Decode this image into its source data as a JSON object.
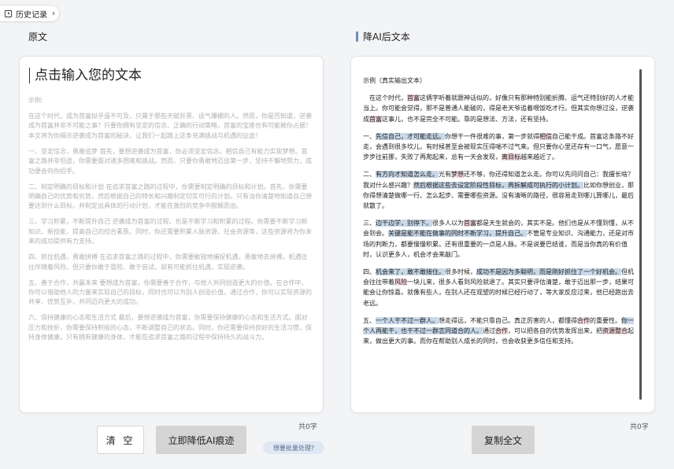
{
  "history": {
    "label": "历史记录"
  },
  "left": {
    "label": "原文",
    "placeholder": "点击输入您的文本",
    "sample": [
      "示例:",
      "在这个时代，成为首富似乎遥不可及，只属于那些天赋异禀、运气爆棚的人。然而，你是否知道，逆袭成为首富并非不可能之事？只要你拥有坚定的信念、正确的行动策略，首富的宝座也有可能被你占据！本文将为你揭示逆袭成为首富的秘诀，让我们一起踏上这条充满挑战与机遇的征途！",
      "一、坚定信念，勇敢追梦 首先，要想逆袭成为首富，你必须坚定信念。相信自己有能力实现梦想。首富之路并非坦途，你需要面对诸多困难和挑战。然而，只要你勇敢地迈出第一步，坚持不懈地努力，成功便会向你招手。",
      "二、制定明确的目标和计划 在追求首富之路的过程中，你需要制定明确的目标和计划。首先，你需要明确自己的优势和劣势，然后根据自己的特长和兴趣制定切实可行的计划。只有当你清楚地知道自己想要达到什么目标，并制定出具体的行动计划，才能在激烈的竞争中脱颖而出。",
      "三、学习积累，不断提升自己 逆袭成为首富的过程，也是不断学习和积累的过程。你需要不断学习新知识、新技能，提高自己的综合素质。同时，你还需要积累人脉资源、社会资源等，这些资源将为你未来的成功提供有力支持。",
      "四、抓住机遇，勇敢拼搏 在追求首富之路的过程中，你需要敏锐地捕捉机遇，勇敢地去拼搏。机遇往往伴随着风险，但只要你敢于冒险、敢于尝试，就有可能抓住机遇，实现逆袭。",
      "五、善于合作，共赢未来 要想成为首富，你需要善于合作，与他人共同创造更大的价值。在合作中，你可以借助他人的力量来实现自己的目标，同时也可以为别人创造价值。通过合作，你可以实现资源的共享、优势互补，共同迈向更大的成功。",
      "六、保持健康的心态和生活方式 最后，要想逆袭成为首富，你需要保持健康的心态和生活方式。面对压力和挫折，你需要保持积极的心态，不断调整自己的状态。同时，你还需要保持良好的生活习惯，保持身体健康。只有拥有健康的身体，才能在追求首富之路的过程中保持持久的战斗力。"
    ],
    "count": "共0字",
    "clear_label": "清 空",
    "reduce_label": "立即降低AI痕迹",
    "batch_label": "想要批量处理?"
  },
  "right": {
    "label": "降AI后文本",
    "count": "共0字",
    "copy_label": "复制全文",
    "output": [
      {
        "segs": [
          {
            "t": "示例（真实输出文本）"
          }
        ]
      },
      {
        "segs": [
          {
            "t": "　在这个时代，"
          },
          {
            "t": "首富",
            "c": "p"
          },
          {
            "t": "这俩字听着就跟神话似的，好像只有那种特别能折腾、运气还特别好的人才能当上。你可能会觉得，那不是普通人能碰的，得是老天爷追着喂饭吃才行。但其实你想过没，逆袭成"
          },
          {
            "t": "首富",
            "c": "p"
          },
          {
            "t": "这事儿，也不是完全不可能。靠的是想法、方法，还有坚持。"
          }
        ]
      },
      {
        "segs": [
          {
            "t": "一、"
          },
          {
            "t": "先信自己，才可能走远。",
            "c": "b"
          },
          {
            "t": "你想干一件很难的事，第一步就得"
          },
          {
            "t": "相信",
            "c": "p"
          },
          {
            "t": "自己能干成。首富这条路不好走，会遇到很多坎儿，有时候甚至会被现实压得喘不过气来。但只要你心里还存有一口气，愿意一步步往前挪，失败了再爬起来，总有一天会发现，"
          },
          {
            "t": "离目标",
            "c": "p"
          },
          {
            "t": "越来越近了。"
          }
        ]
      },
      {
        "segs": [
          {
            "t": "二、"
          },
          {
            "t": "有方向才知道怎么走。",
            "c": "b"
          },
          {
            "t": "光有"
          },
          {
            "t": "梦想",
            "c": "p"
          },
          {
            "t": "还不够，你还得知道怎么走。你可以先问问自己：我擅长啥？我对什么感兴趣？"
          },
          {
            "t": "然后根据这些去设定阶段性目标，再拆解成可执行的小计划。",
            "c": "b"
          },
          {
            "t": "比如你想创业，那你得想清楚做哪一行、怎么起步、需要哪些资源。没有清晰的路径，很容易走到哪儿算哪儿，最后就散了。"
          }
        ]
      },
      {
        "segs": [
          {
            "t": "三、"
          },
          {
            "t": "边干边学，别停下。",
            "c": "b"
          },
          {
            "t": "很多人以为"
          },
          {
            "t": "首富",
            "c": "p"
          },
          {
            "t": "都是天生就会的，其实不是。他们也是从不懂到懂，从不会到会。"
          },
          {
            "t": "关键是能不能在做事的同时不断学习，提升自己。",
            "c": "b"
          },
          {
            "t": "不管是专业知识、沟通能力，还是对市场的判断力，都要慢慢积累。还有很重要的一点是人脉。不是说要巴结谁，而是当你真的有价值时，认识更多人，机会才会来敲门。"
          }
        ]
      },
      {
        "segs": [
          {
            "t": "四、"
          },
          {
            "t": "机会来了，敢不敢接住。",
            "c": "b"
          },
          {
            "t": "很多时候，"
          },
          {
            "t": "成功不是因为多聪明，而是刚好抓住了一个好机会。",
            "c": "b"
          },
          {
            "t": "但机会往往带着"
          },
          {
            "t": "风险",
            "c": "p"
          },
          {
            "t": "一块儿来，很多人看到风险就退了。其实只要评估清楚，敢于迈出那一步，结果可能会让你惊喜。就像有些人，在别人还在观望的时候已经行动了，等大家反应过来，他已经跑出去老远。"
          }
        ]
      },
      {
        "segs": [
          {
            "t": "五、"
          },
          {
            "t": "一个人干不过一群人。",
            "c": "b"
          },
          {
            "t": "想走得远，不能只靠自己。真正厉害的人，都懂得"
          },
          {
            "t": "合作",
            "c": "p"
          },
          {
            "t": "的重要性。"
          },
          {
            "t": "你一个人再能干，也干不过一群志同道合的人。",
            "c": "b"
          },
          {
            "t": "通过"
          },
          {
            "t": "合作",
            "c": "p"
          },
          {
            "t": "，可以把各自的优势发挥出来，把"
          },
          {
            "t": "资源整合",
            "c": "p"
          },
          {
            "t": "起来，做出更大的事。而你在帮助别人成长的同时，也会收获更多信任和支持。"
          }
        ]
      }
    ]
  },
  "colors": {
    "accent": "#6b8fbf",
    "highlight_blue": "#c9d9ea",
    "highlight_pink": "#f3d9dd"
  },
  "icons": {
    "history": "clock-icon",
    "chevron": "chevron-right-icon"
  }
}
